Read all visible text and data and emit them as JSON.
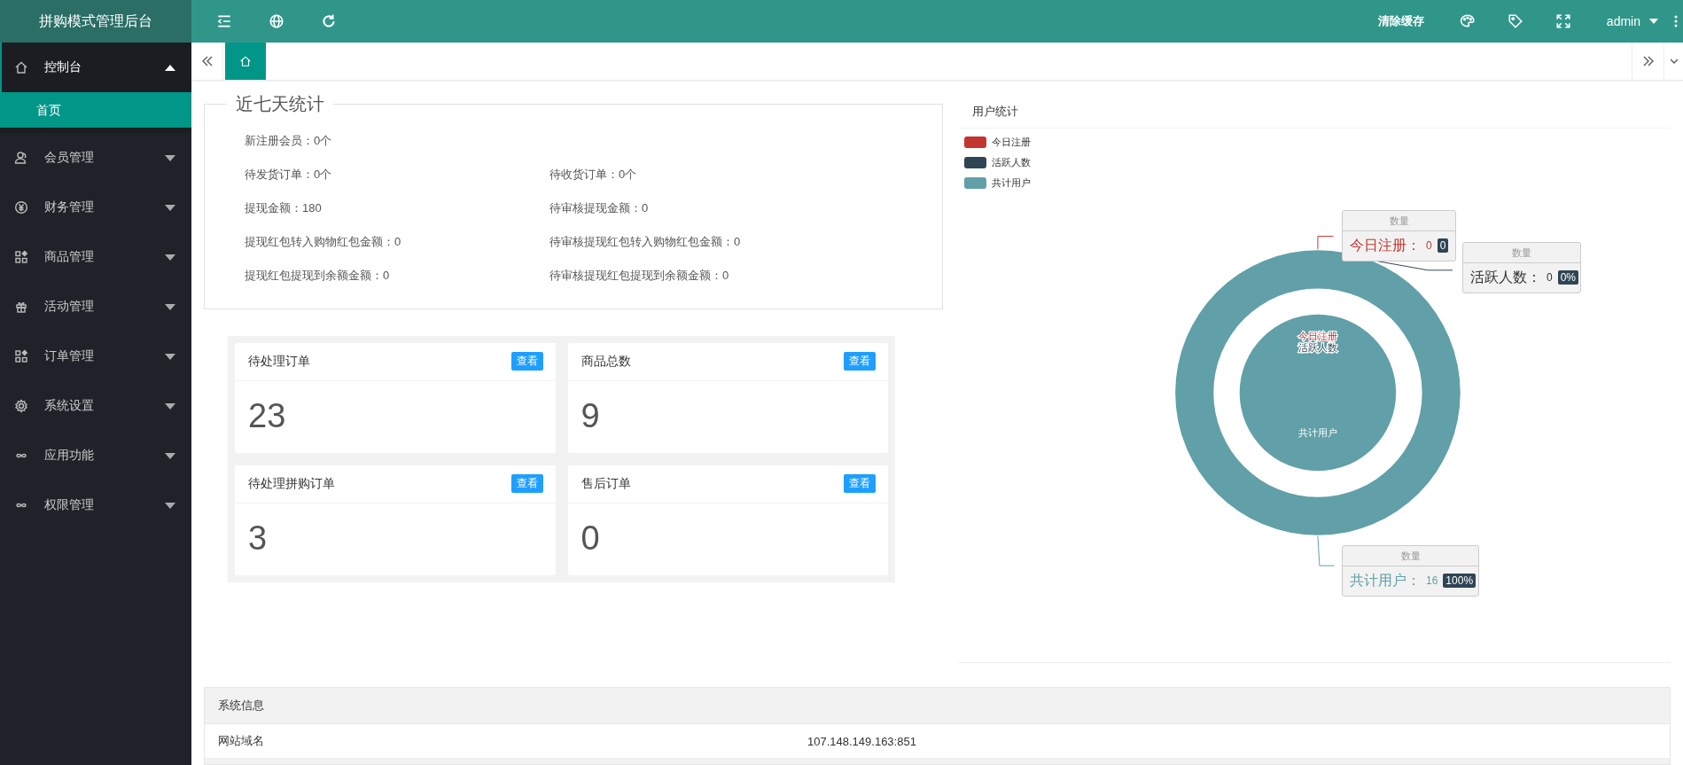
{
  "header": {
    "title": "拼购模式管理后台",
    "clear_cache": "清除缓存",
    "user": "admin"
  },
  "sidebar": {
    "items": [
      {
        "label": "控制台",
        "expanded": true,
        "children": [
          {
            "label": "首页",
            "selected": true
          }
        ]
      },
      {
        "label": "会员管理",
        "expanded": false
      },
      {
        "label": "财务管理",
        "expanded": false
      },
      {
        "label": "商品管理",
        "expanded": false
      },
      {
        "label": "活动管理",
        "expanded": false
      },
      {
        "label": "订单管理",
        "expanded": false
      },
      {
        "label": "系统设置",
        "expanded": false
      },
      {
        "label": "应用功能",
        "expanded": false
      },
      {
        "label": "权限管理",
        "expanded": false
      }
    ]
  },
  "tabs": [
    {
      "kind": "home",
      "selected": true
    }
  ],
  "weekly_stats": {
    "title": "近七天统计",
    "rows": [
      [
        "新注册会员：0个"
      ],
      [
        "待发货订单：0个",
        "待收货订单：0个"
      ],
      [
        "提现金额：180",
        "待审核提现金额：0"
      ],
      [
        "提现红包转入购物红包金额：0",
        "待审核提现红包转入购物红包金额：0"
      ],
      [
        "提现红包提现到余额金额：0",
        "待审核提现红包提现到余额金额：0"
      ]
    ]
  },
  "cards": [
    {
      "title": "待处理订单",
      "button": "查看",
      "value": "23"
    },
    {
      "title": "商品总数",
      "button": "查看",
      "value": "9"
    },
    {
      "title": "待处理拼购订单",
      "button": "查看",
      "value": "3"
    },
    {
      "title": "售后订单",
      "button": "查看",
      "value": "0"
    }
  ],
  "user_stats": {
    "title": "用户统计",
    "legend": [
      {
        "label": "今日注册",
        "color": "#c23531"
      },
      {
        "label": "活跃人数",
        "color": "#2f4554"
      },
      {
        "label": "共计用户",
        "color": "#61a0a8"
      }
    ],
    "chart_data": {
      "type": "donut",
      "categories": [
        "今日注册",
        "活跃人数",
        "共计用户"
      ],
      "values": [
        0,
        0,
        100
      ]
    },
    "callouts": [
      {
        "title": "数量",
        "name": "今日注册：",
        "value": "0",
        "percent": "0"
      },
      {
        "title": "数量",
        "name": "活跃人数：",
        "value": "0",
        "percent": "0%"
      },
      {
        "title": "数量",
        "name": "共计用户：",
        "value": "16",
        "percent": "100%"
      }
    ]
  },
  "system_info": {
    "title": "系统信息",
    "rows": [
      {
        "label": "网站域名",
        "value": "107.148.149.163:851"
      }
    ]
  }
}
